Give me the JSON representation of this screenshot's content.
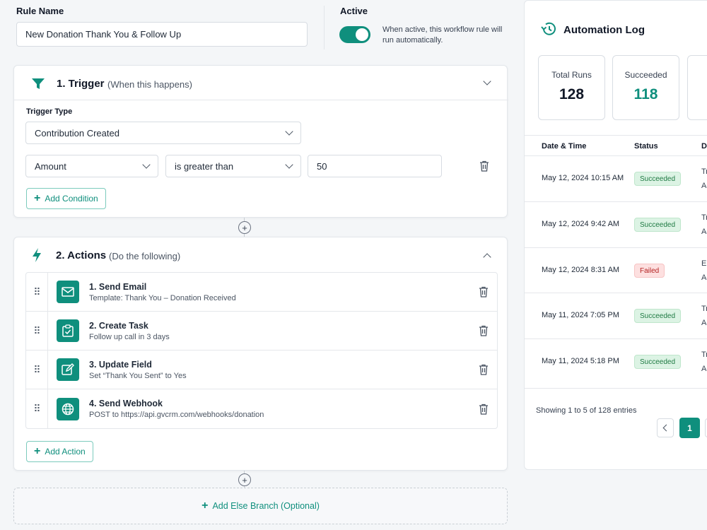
{
  "rule": {
    "label": "Rule Name",
    "value": "New Donation Thank You & Follow Up"
  },
  "active": {
    "label": "Active",
    "on": true,
    "help": "When active, this workflow rule will run automatically."
  },
  "trigger": {
    "title": "1. Trigger",
    "subtitle": "(When this happens)",
    "type_label": "Trigger Type",
    "type_value": "Contribution Created",
    "condition": {
      "field": "Amount",
      "operator": "is greater than",
      "value": "50"
    },
    "add_condition": "Add Condition"
  },
  "actions": {
    "title": "2. Actions",
    "subtitle": "(Do the following)",
    "items": [
      {
        "title": "1. Send Email",
        "sub": "Template: Thank You – Donation Received",
        "icon": "mail-icon"
      },
      {
        "title": "2. Create Task",
        "sub": "Follow up call in 3 days",
        "icon": "clipboard-check-icon"
      },
      {
        "title": "3. Update Field",
        "sub": "Set “Thank You Sent” to Yes",
        "icon": "edit-icon"
      },
      {
        "title": "4. Send Webhook",
        "sub": "POST to https://api.gvcrm.com/webhooks/donation",
        "icon": "globe-icon"
      }
    ],
    "add_action": "Add Action"
  },
  "else_branch": "Add Else Branch (Optional)",
  "log": {
    "title": "Automation Log",
    "stats": [
      {
        "label": "Total Runs",
        "value": "128"
      },
      {
        "label": "Succeeded",
        "value": "118"
      }
    ],
    "columns": [
      "Date & Time",
      "Status",
      "De"
    ],
    "rows": [
      {
        "date": "May 12, 2024 10:15 AM",
        "status": "Succeeded",
        "d1": "Tr",
        "d2": "Ac"
      },
      {
        "date": "May 12, 2024 9:42 AM",
        "status": "Succeeded",
        "d1": "Tr",
        "d2": "Ac"
      },
      {
        "date": "May 12, 2024 8:31 AM",
        "status": "Failed",
        "d1": "Er",
        "d2": "Ac"
      },
      {
        "date": "May 11, 2024 7:05 PM",
        "status": "Succeeded",
        "d1": "Tr",
        "d2": "Ac"
      },
      {
        "date": "May 11, 2024 5:18 PM",
        "status": "Succeeded",
        "d1": "Tr",
        "d2": "Ac"
      }
    ],
    "showing": "Showing 1 to 5 of 128 entries",
    "page": "1"
  },
  "colors": {
    "accent": "#0f8f7d",
    "success_bg": "#dcf3e4",
    "fail_bg": "#fde0e0"
  }
}
